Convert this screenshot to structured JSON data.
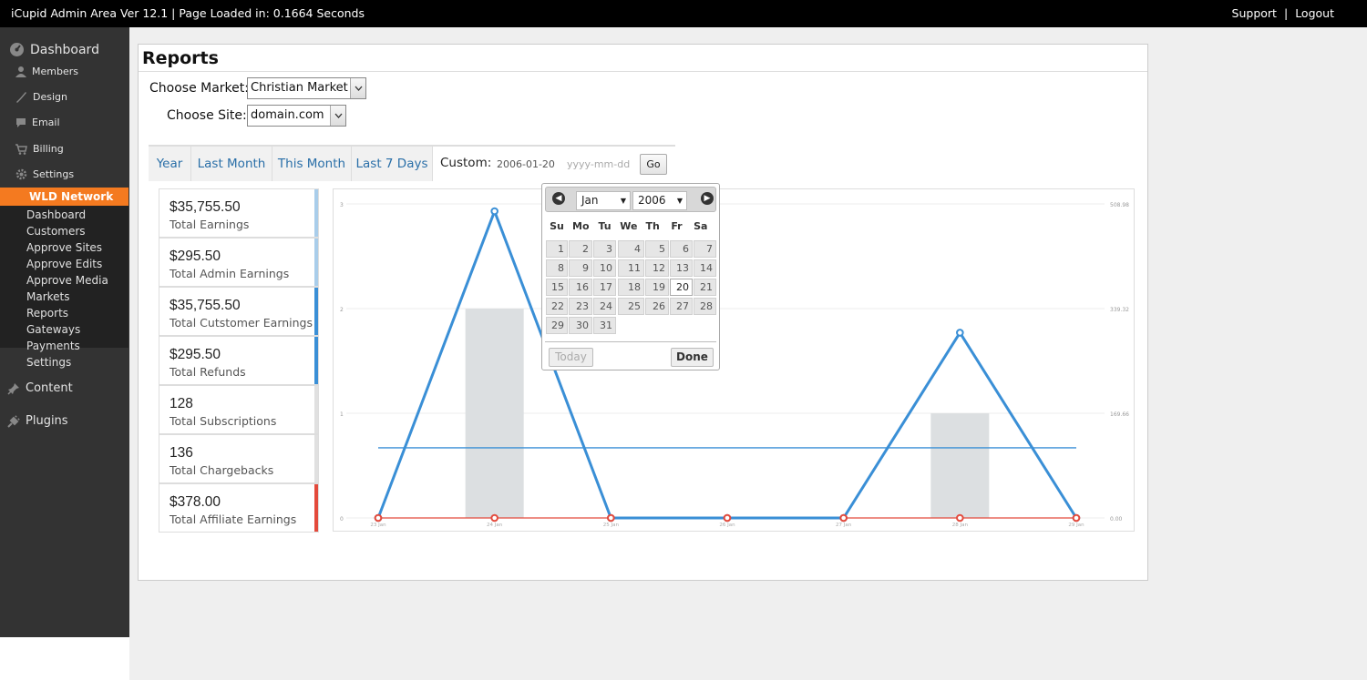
{
  "topbar": {
    "title": "iCupid Admin Area Ver 12.1 | Page Loaded in: 0.1664 Seconds",
    "support": "Support",
    "separator": "|",
    "logout": "Logout"
  },
  "sidebar": {
    "dashboard": "Dashboard",
    "members": "Members",
    "design": "Design",
    "email": "Email",
    "billing": "Billing",
    "settings": "Settings",
    "network": "WLD Network",
    "subitems": [
      "Dashboard",
      "Customers",
      "Approve Sites",
      "Approve Edits",
      "Approve Media",
      "Markets",
      "Reports",
      "Gateways",
      "Payments",
      "Settings"
    ],
    "content": "Content",
    "plugins": "Plugins"
  },
  "page": {
    "title": "Reports",
    "market_label": "Choose Market:",
    "market_value": "Christian Market",
    "site_label": "Choose Site:",
    "site_value": "domain.com"
  },
  "tabs": {
    "year": "Year",
    "last_month": "Last Month",
    "this_month": "This Month",
    "last_7_days": "Last 7 Days",
    "custom_label": "Custom:",
    "start_date": "2006-01-20",
    "end_placeholder": "yyyy-mm-dd",
    "go": "Go"
  },
  "stats": [
    {
      "value": "$35,755.50",
      "label": "Total Earnings",
      "color": "#a9cdea"
    },
    {
      "value": "$295.50",
      "label": "Total Admin Earnings",
      "color": "#a9cdea"
    },
    {
      "value": "$35,755.50",
      "label": "Total Cutstomer Earnings",
      "color": "#3a8fd6"
    },
    {
      "value": "$295.50",
      "label": "Total Refunds",
      "color": "#3a8fd6"
    },
    {
      "value": "128",
      "label": "Total Subscriptions",
      "color": "#e0e0e0"
    },
    {
      "value": "136",
      "label": "Total Chargebacks",
      "color": "#e0e0e0"
    },
    {
      "value": "$378.00",
      "label": "Total Affiliate Earnings",
      "color": "#e34a3c"
    }
  ],
  "chart_data": {
    "type": "line",
    "categories": [
      "23 Jan",
      "24 Jan",
      "25 Jan",
      "26 Jan",
      "27 Jan",
      "28 Jan",
      "29 Jan"
    ],
    "series": [
      {
        "type": "bar",
        "values": [
          0,
          2,
          0,
          0,
          0,
          1,
          0
        ],
        "color": "#dcdfe1"
      },
      {
        "type": "line",
        "values": [
          0,
          2.93,
          0,
          0,
          0,
          1.77,
          0
        ],
        "color": "#3a8fd6"
      },
      {
        "type": "line",
        "values": [
          0,
          0,
          0,
          0,
          0,
          0,
          0
        ],
        "color": "#e34a3c"
      },
      {
        "type": "hline",
        "values": [
          0.67
        ],
        "color": "#3a8fd6"
      }
    ],
    "y_left_ticks": [
      "0",
      "1",
      "2",
      "3"
    ],
    "y_right_ticks": [
      "0.00",
      "169.66",
      "339.32",
      "508.98"
    ],
    "ylim": [
      0,
      3
    ]
  },
  "datepicker": {
    "prev": "◀",
    "next": "▶",
    "month": "Jan",
    "year": "2006",
    "dow": [
      "Su",
      "Mo",
      "Tu",
      "We",
      "Th",
      "Fr",
      "Sa"
    ],
    "days": [
      "1",
      "2",
      "3",
      "4",
      "5",
      "6",
      "7",
      "8",
      "9",
      "10",
      "11",
      "12",
      "13",
      "14",
      "15",
      "16",
      "17",
      "18",
      "19",
      "20",
      "21",
      "22",
      "23",
      "24",
      "25",
      "26",
      "27",
      "28",
      "29",
      "30",
      "31"
    ],
    "active_day": "20",
    "today": "Today",
    "done": "Done"
  }
}
